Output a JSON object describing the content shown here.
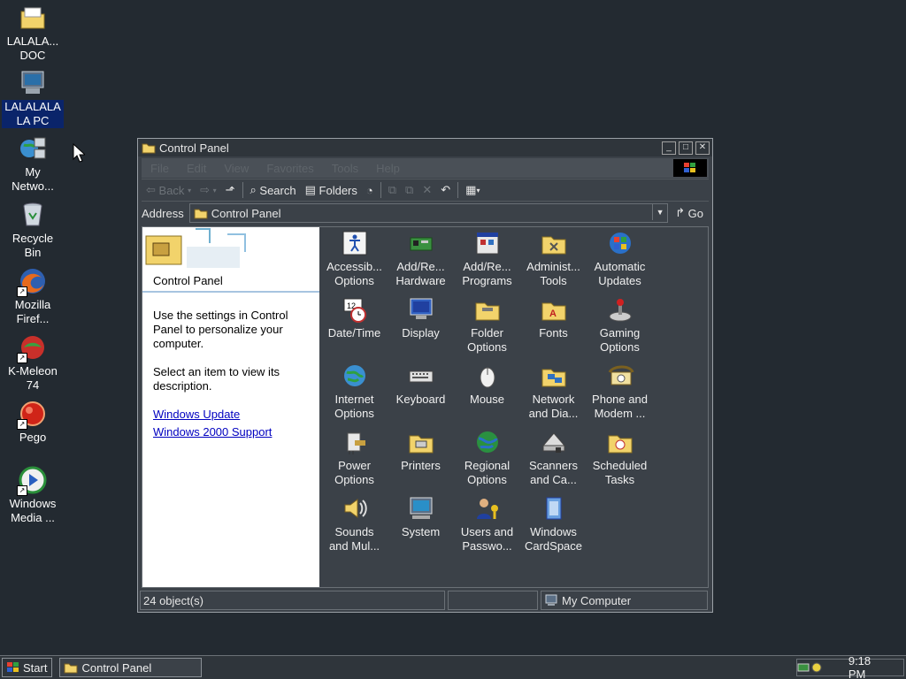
{
  "desktop": {
    "icons": [
      {
        "label": "LALALA... DOC",
        "icon": "folder-icon"
      },
      {
        "label": "LALALALA LA PC",
        "icon": "computer-icon"
      },
      {
        "label": "My Netwo...",
        "icon": "network-icon"
      },
      {
        "label": "Recycle Bin",
        "icon": "recycle-bin-icon"
      },
      {
        "label": "Mozilla Firef...",
        "icon": "firefox-icon"
      },
      {
        "label": "K-Meleon 74",
        "icon": "kmeleon-icon"
      },
      {
        "label": "Pego",
        "icon": "pego-icon"
      },
      {
        "label": "Windows Media ...",
        "icon": "media-player-icon"
      }
    ]
  },
  "window": {
    "title": "Control Panel",
    "menu": [
      "File",
      "Edit",
      "View",
      "Favorites",
      "Tools",
      "Help"
    ],
    "toolbar": {
      "back": "Back",
      "search": "Search",
      "folders": "Folders"
    },
    "address": {
      "label": "Address",
      "value": "Control Panel",
      "go": "Go"
    },
    "left_pane": {
      "title": "Control Panel",
      "text1": "Use the settings in Control Panel to personalize your computer.",
      "text2": "Select an item to view its description.",
      "links": [
        "Windows Update",
        "Windows 2000 Support"
      ]
    },
    "items": [
      {
        "l1": "Accessib...",
        "l2": "Options",
        "icon": "accessibility-icon"
      },
      {
        "l1": "Add/Re...",
        "l2": "Hardware",
        "icon": "hardware-icon"
      },
      {
        "l1": "Add/Re...",
        "l2": "Programs",
        "icon": "programs-icon"
      },
      {
        "l1": "Administ...",
        "l2": "Tools",
        "icon": "admin-tools-icon"
      },
      {
        "l1": "Automatic",
        "l2": "Updates",
        "icon": "updates-icon"
      },
      {
        "l1": "Date/Time",
        "l2": "",
        "icon": "clock-icon"
      },
      {
        "l1": "Display",
        "l2": "",
        "icon": "display-icon"
      },
      {
        "l1": "Folder",
        "l2": "Options",
        "icon": "folder-options-icon"
      },
      {
        "l1": "Fonts",
        "l2": "",
        "icon": "fonts-icon"
      },
      {
        "l1": "Gaming",
        "l2": "Options",
        "icon": "joystick-icon"
      },
      {
        "l1": "Internet",
        "l2": "Options",
        "icon": "globe-icon"
      },
      {
        "l1": "Keyboard",
        "l2": "",
        "icon": "keyboard-icon"
      },
      {
        "l1": "Mouse",
        "l2": "",
        "icon": "mouse-icon"
      },
      {
        "l1": "Network",
        "l2": "and Dia...",
        "icon": "network-folder-icon"
      },
      {
        "l1": "Phone and",
        "l2": "Modem ...",
        "icon": "phone-icon"
      },
      {
        "l1": "Power",
        "l2": "Options",
        "icon": "power-icon"
      },
      {
        "l1": "Printers",
        "l2": "",
        "icon": "printer-icon"
      },
      {
        "l1": "Regional",
        "l2": "Options",
        "icon": "regional-globe-icon"
      },
      {
        "l1": "Scanners",
        "l2": "and Ca...",
        "icon": "scanner-icon"
      },
      {
        "l1": "Scheduled",
        "l2": "Tasks",
        "icon": "tasks-icon"
      },
      {
        "l1": "Sounds",
        "l2": "and Mul...",
        "icon": "speaker-icon"
      },
      {
        "l1": "System",
        "l2": "",
        "icon": "system-icon"
      },
      {
        "l1": "Users and",
        "l2": "Passwo...",
        "icon": "users-icon"
      },
      {
        "l1": "Windows",
        "l2": "CardSpace",
        "icon": "cardspace-icon"
      }
    ],
    "status": {
      "count": "24 object(s)",
      "zone": "My Computer"
    }
  },
  "taskbar": {
    "start": "Start",
    "task": "Control Panel",
    "clock": "9:18 PM"
  },
  "colors": {
    "desktop": "#232a31",
    "window": "#3b4148",
    "link": "#0000c0",
    "selection": "#0a246a"
  }
}
